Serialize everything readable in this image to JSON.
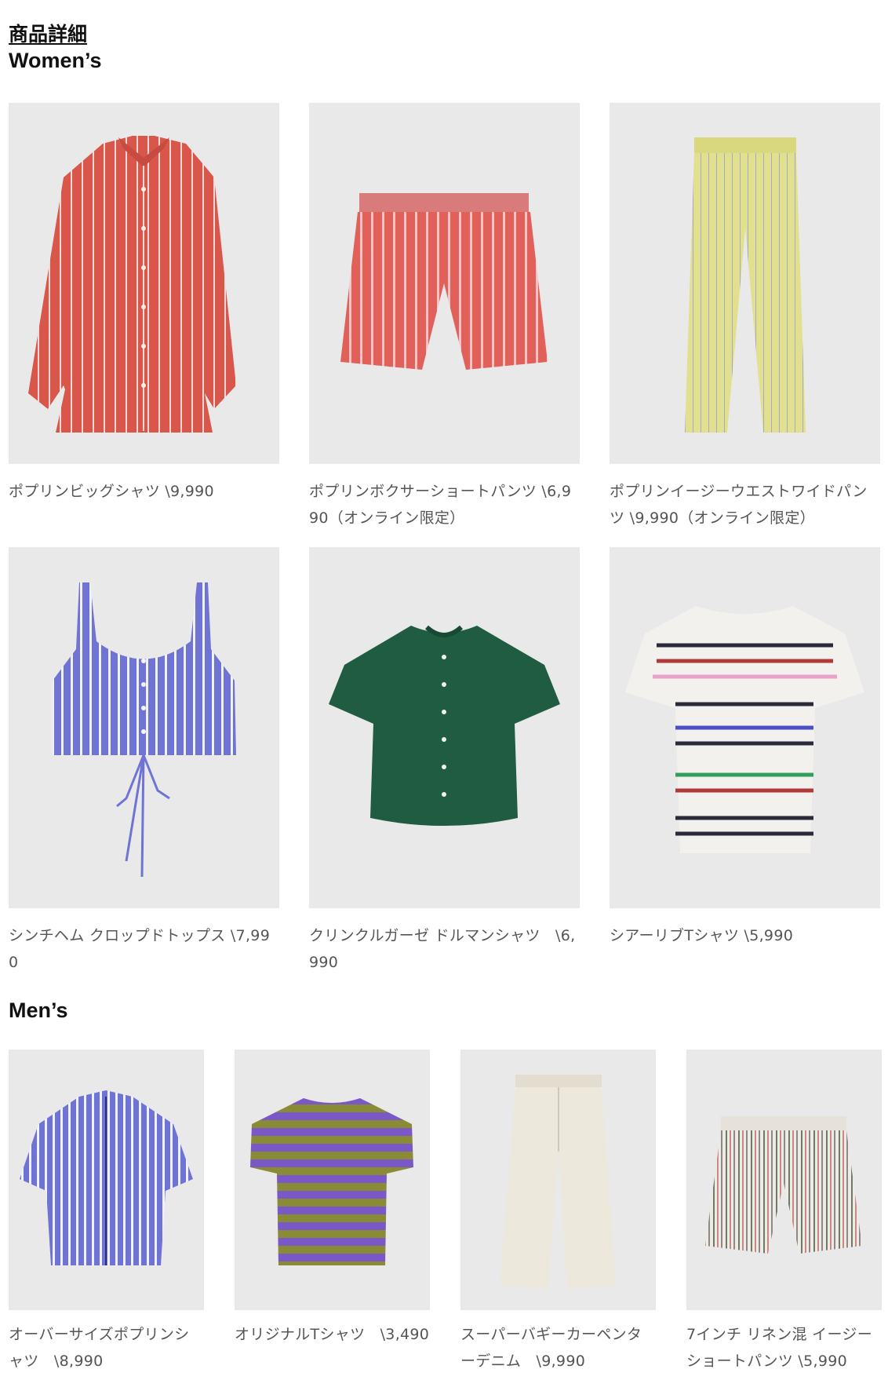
{
  "section_link": "商品詳細",
  "womens": {
    "heading": "Women’s",
    "items": [
      {
        "caption": "ポプリンビッグシャツ \\9,990",
        "image": "red-striped-shirt"
      },
      {
        "caption": "ポプリンボクサーショートパンツ \\6,990（オンライン限定）",
        "image": "red-striped-boxer-shorts"
      },
      {
        "caption": "ポプリンイージーウエストワイドパンツ \\9,990（オンライン限定）",
        "image": "yellow-striped-wide-pants"
      },
      {
        "caption": "シンチヘム クロップドトップス \\7,990",
        "image": "blue-striped-crop-top"
      },
      {
        "caption": "クリンクルガーゼ ドルマンシャツ　\\6,990",
        "image": "green-dolman-shirt"
      },
      {
        "caption": "シアーリブTシャツ \\5,990",
        "image": "multistripe-sheer-tee"
      }
    ]
  },
  "mens": {
    "heading": "Men’s",
    "items": [
      {
        "caption": "オーバーサイズポプリンシャツ　\\8,990",
        "image": "blue-striped-oversized-shirt"
      },
      {
        "caption": "オリジナルTシャツ　\\3,490",
        "image": "purple-green-striped-tee"
      },
      {
        "caption": "スーパーバギーカーペンターデニム　\\9,990",
        "image": "cream-carpenter-denim"
      },
      {
        "caption": "7インチ リネン混 イージーショートパンツ \\5,990",
        "image": "striped-linen-shorts"
      }
    ]
  },
  "colors": {
    "image_bg": "#e9e9e9",
    "red_stripe": "#d8564a",
    "yellow": "#e1e08e",
    "blue_stripe": "#6f74d4",
    "green": "#1f5c41",
    "purple": "#7a58c8",
    "olive": "#8a8b35",
    "cream": "#ece8dc"
  }
}
